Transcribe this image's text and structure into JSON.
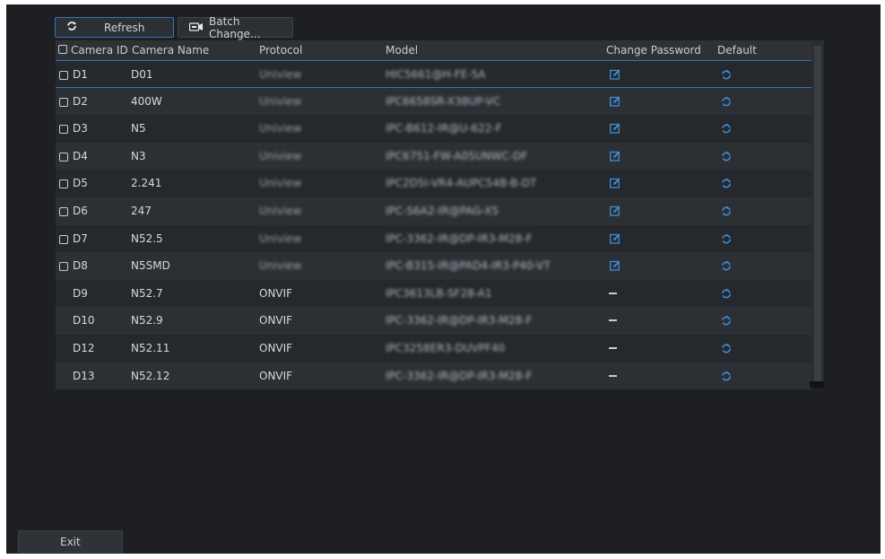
{
  "toolbar": {
    "refresh_label": "Refresh",
    "batch_label": "Batch Change..."
  },
  "table": {
    "headers": {
      "camera_id": "Camera ID",
      "camera_name": "Camera Name",
      "protocol": "Protocol",
      "model": "Model",
      "change_password": "Change Password",
      "default": "Default"
    },
    "rows": [
      {
        "id": "D1",
        "name": "D01",
        "protocol": "Uniview",
        "model": "HIC5661@H-FE-5A",
        "checkbox": true,
        "password_editable": true
      },
      {
        "id": "D2",
        "name": "400W",
        "protocol": "Uniview",
        "model": "IPC6658SR-X38UP-VC",
        "checkbox": true,
        "password_editable": true
      },
      {
        "id": "D3",
        "name": "N5",
        "protocol": "Uniview",
        "model": "IPC-B612-IR@U-622-F",
        "checkbox": true,
        "password_editable": true
      },
      {
        "id": "D4",
        "name": "N3",
        "protocol": "Uniview",
        "model": "IPC6751-FW-A05UNWC-DF",
        "checkbox": true,
        "password_editable": true
      },
      {
        "id": "D5",
        "name": "2.241",
        "protocol": "Uniview",
        "model": "IPC2D5I-VR4-AUPC54B-B-DT",
        "checkbox": true,
        "password_editable": true
      },
      {
        "id": "D6",
        "name": "247",
        "protocol": "Uniview",
        "model": "IPC-S6A2-IR@PAG-X5",
        "checkbox": true,
        "password_editable": true
      },
      {
        "id": "D7",
        "name": "N52.5",
        "protocol": "Uniview",
        "model": "IPC-3362-IR@DP-IR3-M28-F",
        "checkbox": true,
        "password_editable": true
      },
      {
        "id": "D8",
        "name": "N5SMD",
        "protocol": "Uniview",
        "model": "IPC-B315-IR@PAD4-IR3-P40-VT",
        "checkbox": true,
        "password_editable": true
      },
      {
        "id": "D9",
        "name": "N52.7",
        "protocol": "ONVIF",
        "model": "IPC3613LB-SF28-A1",
        "checkbox": false,
        "password_editable": false
      },
      {
        "id": "D10",
        "name": "N52.9",
        "protocol": "ONVIF",
        "model": "IPC-3362-IR@DP-IR3-M28-F",
        "checkbox": false,
        "password_editable": false
      },
      {
        "id": "D12",
        "name": "N52.11",
        "protocol": "ONVIF",
        "model": "IPC3258ER3-DUVPF40",
        "checkbox": false,
        "password_editable": false
      },
      {
        "id": "D13",
        "name": "N52.12",
        "protocol": "ONVIF",
        "model": "IPC-3362-IR@DP-IR3-M28-F",
        "checkbox": false,
        "password_editable": false
      }
    ]
  },
  "footer": {
    "exit_label": "Exit"
  },
  "colors": {
    "background": "#1d1f22",
    "accent": "#3a73b8",
    "icon_blue": "#3d8fd9"
  }
}
